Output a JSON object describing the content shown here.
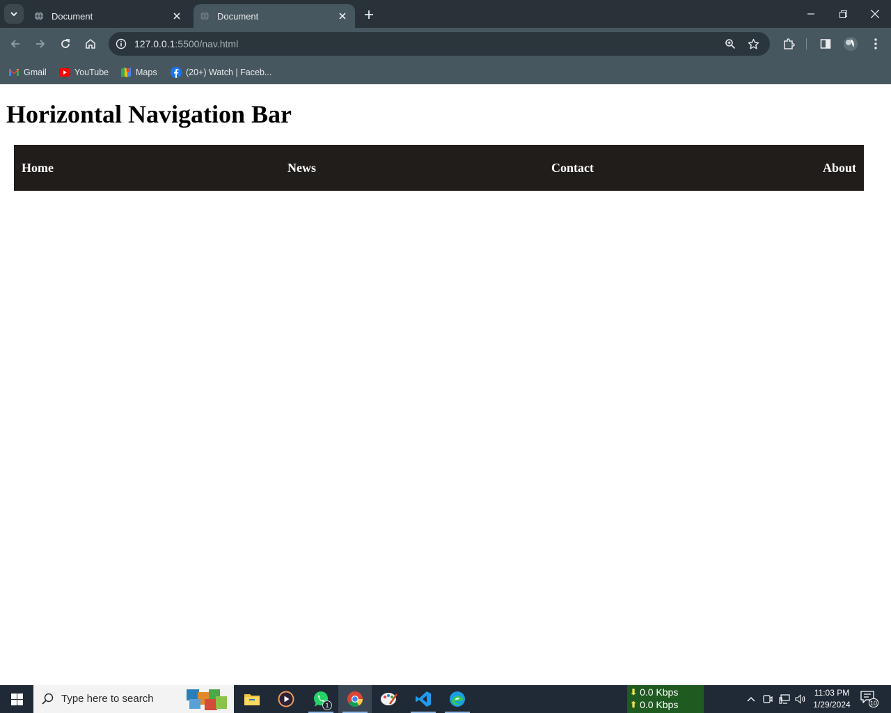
{
  "browser": {
    "tabs": [
      {
        "title": "Document",
        "active": false
      },
      {
        "title": "Document",
        "active": true
      }
    ],
    "address": {
      "host": "127.0.0.1",
      "rest": ":5500/nav.html"
    },
    "bookmarks": [
      {
        "label": "Gmail",
        "icon": "gmail-icon"
      },
      {
        "label": "YouTube",
        "icon": "youtube-icon"
      },
      {
        "label": "Maps",
        "icon": "maps-icon"
      },
      {
        "label": "(20+) Watch | Faceb...",
        "icon": "facebook-icon"
      }
    ]
  },
  "page": {
    "title": "Horizontal Navigation Bar",
    "nav": [
      {
        "label": "Home"
      },
      {
        "label": "News"
      },
      {
        "label": "Contact"
      },
      {
        "label": "About"
      }
    ],
    "nav_background": "#201d1b"
  },
  "taskbar": {
    "search_placeholder": "Type here to search",
    "apps": [
      "file-explorer-icon",
      "media-player-icon",
      "whatsapp-icon",
      "chrome-icon",
      "paint-icon",
      "vscode-icon",
      "edge-icon"
    ],
    "whatsapp_badge": "1",
    "net_down": "0.0 Kbps",
    "net_up": "0.0 Kbps",
    "time": "11:03 PM",
    "date": "1/29/2024",
    "notifications": "10"
  },
  "colors": {
    "tabstrip": "#293238",
    "toolbar": "#47575f",
    "taskbar": "#202a36",
    "net_meter": "#1f5a21"
  }
}
